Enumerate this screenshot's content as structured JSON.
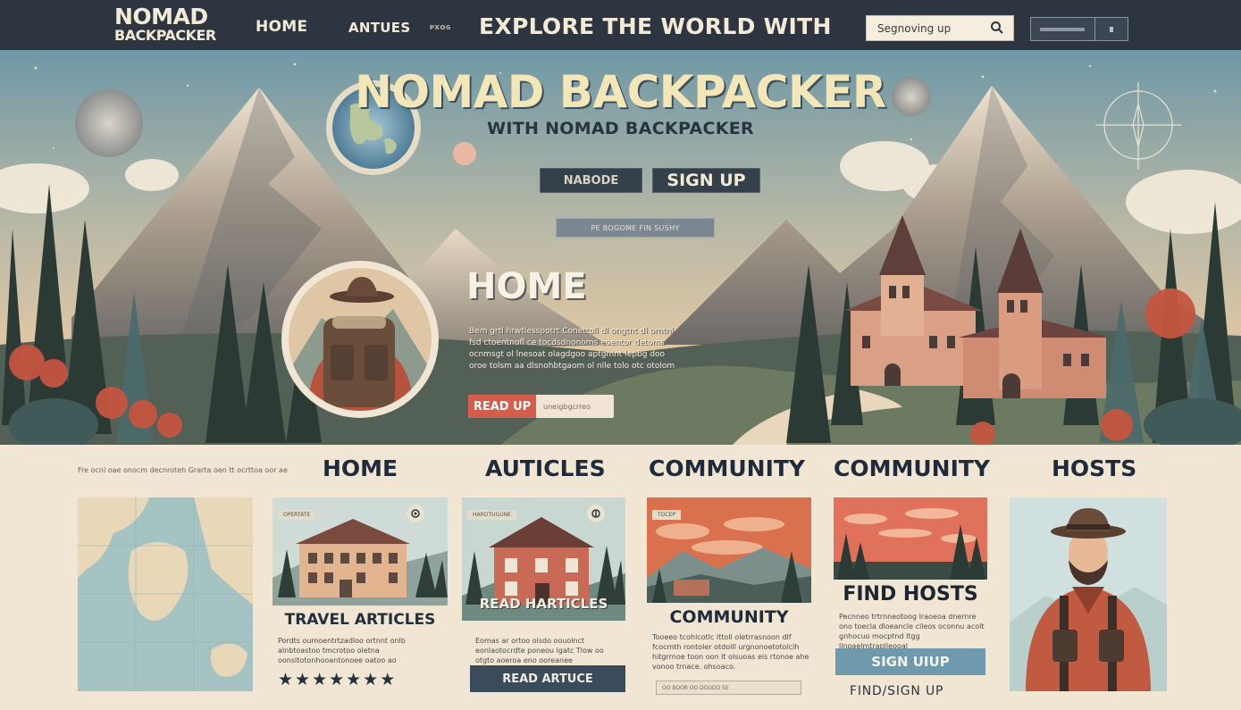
{
  "header": {
    "logo_line1": "NOMAD",
    "logo_line2": "BACKPACKER",
    "nav_home": "HOME",
    "nav_antues": "ANTUES",
    "nav_small": "ᴘxᴏɢ",
    "tagline": "EXPLORE THE WORLD WITH",
    "search_value": "Segnoving up"
  },
  "hero": {
    "title": "NOMAD BACKPACKER",
    "subtitle": "WITH NOMAD BACKPACKER",
    "nab_button": "NABODE",
    "signup_button": "SIGN UP",
    "pill_text": "PE BOGOME FIN SUSHY",
    "home_heading": "HOME",
    "body_text": "Bem grtl hrwtlesspotrt Conettoll dl ongtnt dl orntnl fsd ctoentnofl ce tocdsdnonoms eoentor detoms ocnmsgt ol lnesoat olagdgoo aptgmnt lepbg doo oroe tolsm aa dlsnohbtgaom ol nlle tolo otc otolom",
    "readup_button": "READ UP",
    "readup_note": "uneigbgcrreo"
  },
  "sections": {
    "intro_text": "Fre ocnl oae onocm decnroteh Grarta oen tt ocrttoa oor ae",
    "headings": [
      "HOME",
      "AUTICLES",
      "COMMUNITY",
      "COMMUNITY",
      "HOSTS"
    ]
  },
  "cards": {
    "travel": {
      "tag": "OPERTATE",
      "caption": "TRAVEL ARTICLES",
      "body": "Pordts oumoentrtzadloo ortnnt onlb alnbtoastoo tmcrotoo oletna oonsitotonhooantonoee oatoo ao",
      "rating": "★★★★★★★"
    },
    "read": {
      "tag": "HAROTUGUNE",
      "caption": "READ HARTICLES",
      "body": "Eomas ar ortoo olsdo oouolnct eonlaotocrdte poneou lgatc Tlow oo otgto aoeroa eno ooreanee",
      "button": "READ ARTUCE"
    },
    "community": {
      "tag": "TOCEP",
      "caption": "COMMUNITY",
      "body": "Tooeeo tcohlcotlc lttoll oletrrasnoon dlf fcocmth rontoler otdolll urgnonoetotolclh hitgrrnoe toon oon lt olsuoas eis rtonoe ahe vonoo trnace. ohsoaco.",
      "input": "OO BOOB OO DOUDO SE"
    },
    "hosts": {
      "caption": "FIND HOSTS",
      "body": "Pecnneo trtrnneotoog Iraoeoa dnernre ono toecla dloeancle clleos oconnu acolt gnhocuo mocptnd Itgg llnoaelmtraplleooal",
      "button": "SIGN UIUP",
      "link": "FIND/SIGN UP"
    }
  },
  "colors": {
    "nav_bg": "#2c3540",
    "cream": "#f1e6d4",
    "accent_red": "#d45d4b",
    "button_dark": "#3a4c5c",
    "button_blue": "#6f9aae"
  },
  "icons": [
    "search-icon",
    "globe-icon",
    "compass-icon",
    "camera-icon",
    "star-icon"
  ]
}
